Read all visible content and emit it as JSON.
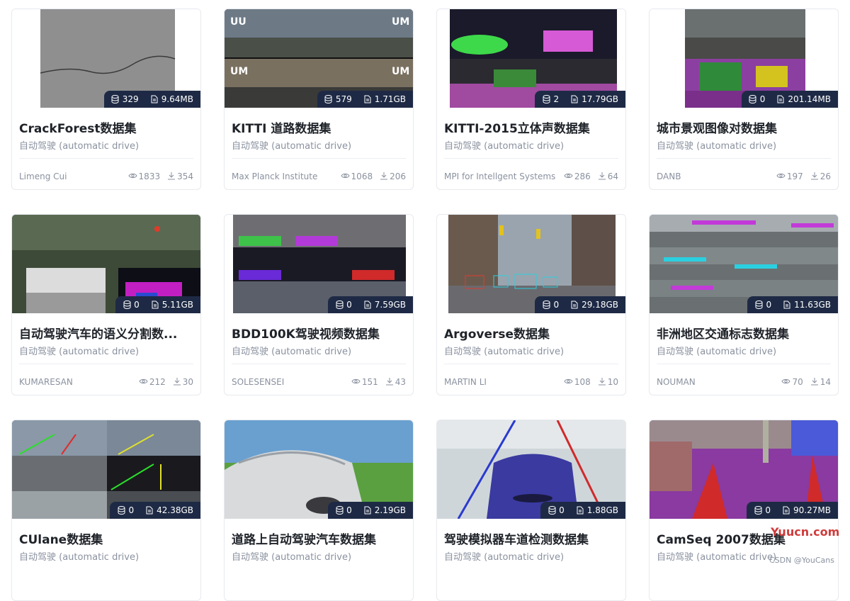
{
  "cards": [
    {
      "title": "CrackForest数据集",
      "category": "自动驾驶 (automatic drive)",
      "author": "Limeng Cui",
      "files": "329",
      "size": "9.64MB",
      "views": "1833",
      "downloads": "354"
    },
    {
      "title": "KITTI 道路数据集",
      "category": "自动驾驶 (automatic drive)",
      "author": "Max Planck Institute",
      "files": "579",
      "size": "1.71GB",
      "views": "1068",
      "downloads": "206"
    },
    {
      "title": "KITTI-2015立体声数据集",
      "category": "自动驾驶 (automatic drive)",
      "author": "MPI for Intellgent Systems",
      "files": "2",
      "size": "17.79GB",
      "views": "286",
      "downloads": "64"
    },
    {
      "title": "城市景观图像对数据集",
      "category": "自动驾驶 (automatic drive)",
      "author": "DANB",
      "files": "0",
      "size": "201.14MB",
      "views": "197",
      "downloads": "26"
    },
    {
      "title": "自动驾驶汽车的语义分割数...",
      "category": "自动驾驶 (automatic drive)",
      "author": "KUMARESAN",
      "files": "0",
      "size": "5.11GB",
      "views": "212",
      "downloads": "30"
    },
    {
      "title": "BDD100K驾驶视频数据集",
      "category": "自动驾驶 (automatic drive)",
      "author": "SOLESENSEI",
      "files": "0",
      "size": "7.59GB",
      "views": "151",
      "downloads": "43"
    },
    {
      "title": "Argoverse数据集",
      "category": "自动驾驶 (automatic drive)",
      "author": "MARTIN LI",
      "files": "0",
      "size": "29.18GB",
      "views": "108",
      "downloads": "10"
    },
    {
      "title": "非洲地区交通标志数据集",
      "category": "自动驾驶 (automatic drive)",
      "author": "NOUMAN",
      "files": "0",
      "size": "11.63GB",
      "views": "70",
      "downloads": "14"
    },
    {
      "title": "CUlane数据集",
      "category": "自动驾驶 (automatic drive)",
      "author": "",
      "files": "0",
      "size": "42.38GB",
      "views": "",
      "downloads": ""
    },
    {
      "title": "道路上自动驾驶汽车数据集",
      "category": "自动驾驶 (automatic drive)",
      "author": "",
      "files": "0",
      "size": "2.19GB",
      "views": "",
      "downloads": ""
    },
    {
      "title": "驾驶模拟器车道检测数据集",
      "category": "自动驾驶 (automatic drive)",
      "author": "",
      "files": "0",
      "size": "1.88GB",
      "views": "",
      "downloads": ""
    },
    {
      "title": "CamSeq 2007数据集",
      "category": "自动驾驶 (automatic drive)",
      "author": "",
      "files": "0",
      "size": "90.27MB",
      "views": "",
      "downloads": ""
    }
  ],
  "thumb_overlays": {
    "um": "UM",
    "uu": "UU"
  },
  "watermark": {
    "text": "Yuucn.com",
    "credit": "CSDN @YouCans"
  },
  "colors": {
    "overlay_bg": "#1e2a45",
    "accent_red": "#d03a3a",
    "muted": "#8a919f"
  }
}
